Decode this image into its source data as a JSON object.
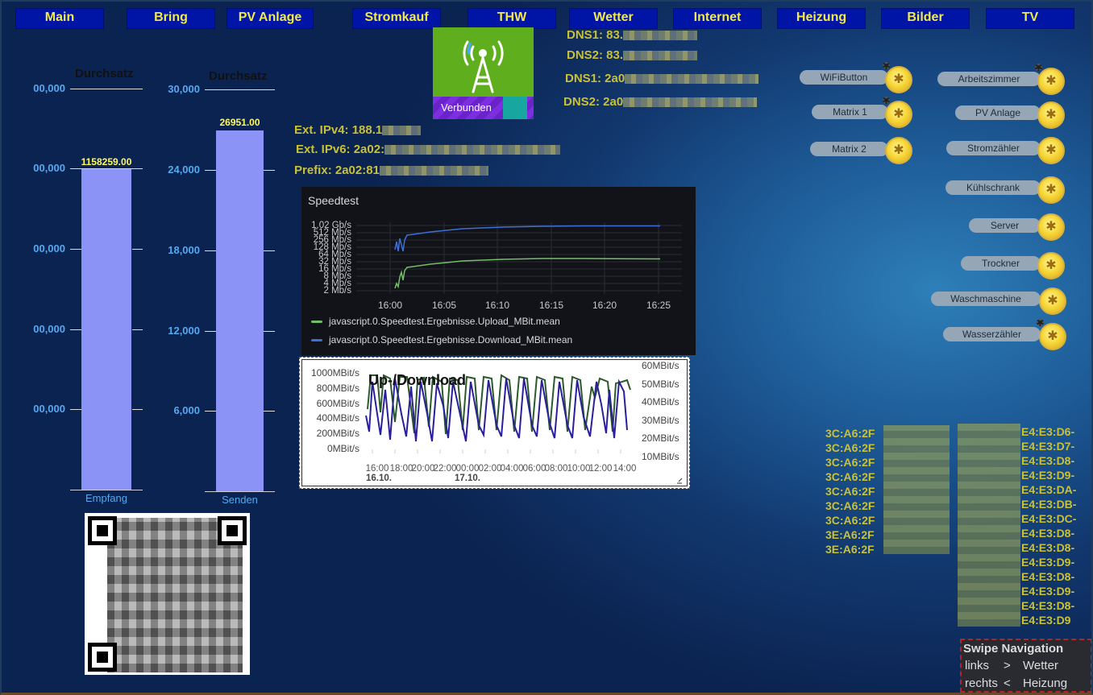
{
  "nav": [
    "Main",
    "Bring",
    "PV Anlage",
    "Stromkauf",
    "THW",
    "Wetter",
    "Internet",
    "Heizung",
    "Bilder",
    "TV"
  ],
  "gauges": {
    "left": {
      "title": "Durchsatz",
      "ticks": [
        "00,000",
        "00,000",
        "00,000",
        "00,000",
        "00,000"
      ],
      "value_label": "1158259.00",
      "value": 1158259,
      "fill_fraction": 0.8,
      "label": "Empfang"
    },
    "right": {
      "title": "Durchsatz",
      "ticks": [
        "30,000",
        "24,000",
        "18,000",
        "12,000",
        "6,000"
      ],
      "value_label": "26951.00",
      "value": 26951,
      "max": 30000,
      "label": "Senden"
    }
  },
  "tile": {
    "icon": "antenna-tower-icon",
    "status": "Verbunden"
  },
  "dns": [
    "DNS1: 83.",
    "DNS2: 83.",
    "DNS1: 2a0",
    "DNS2: 2a0"
  ],
  "ext": [
    "Ext. IPv4: 188.1",
    "Ext. IPv6: 2a02:",
    "Prefix: 2a02:81"
  ],
  "speedtest": {
    "title": "Speedtest",
    "y_labels": [
      "1.02 Gb/s",
      "512 Mb/s",
      "256 Mb/s",
      "128 Mb/s",
      "64 Mb/s",
      "32 Mb/s",
      "16 Mb/s",
      "8 Mb/s",
      "4 Mb/s",
      "2 Mb/s"
    ],
    "x_labels": [
      "16:00",
      "16:05",
      "16:10",
      "16:15",
      "16:20",
      "16:25"
    ],
    "legend": [
      {
        "name": "javascript.0.Speedtest.Ergebnisse.Upload_MBit.mean",
        "color": "#73bf69"
      },
      {
        "name": "javascript.0.Speedtest.Ergebnisse.Download_MBit.mean",
        "color": "#3d6fd8"
      }
    ]
  },
  "updown": {
    "title": "Up-/Download",
    "y_left": [
      "1000MBit/s",
      "800MBit/s",
      "600MBit/s",
      "400MBit/s",
      "200MBit/s",
      "0MBit/s"
    ],
    "y_right": [
      "60MBit/s",
      "50MBit/s",
      "40MBit/s",
      "30MBit/s",
      "20MBit/s",
      "10MBit/s"
    ],
    "x_labels": [
      "16:00",
      "18:00",
      "20:00",
      "22:00",
      "00:00",
      "02:00",
      "04:00",
      "06:00",
      "08:00",
      "10:00",
      "12:00",
      "14:00"
    ],
    "dates": [
      "16.10.",
      "17.10."
    ]
  },
  "switches_left": [
    "WiFiButton",
    "Matrix 1",
    "Matrix 2"
  ],
  "switches_right": [
    "Arbeitszimmer",
    "PV Anlage",
    "Stromzähler",
    "Kühlschrank",
    "Server",
    "Trockner",
    "Waschmaschine",
    "Wasserzähler"
  ],
  "mac_left": [
    "3C:A6:2F",
    "3C:A6:2F",
    "3C:A6:2F",
    "3C:A6:2F",
    "3C:A6:2F",
    "3C:A6:2F",
    "3C:A6:2F",
    "3E:A6:2F",
    "3E:A6:2F"
  ],
  "mac_right": [
    "E4:E3:D6-",
    "E4:E3:D7-",
    "E4:E3:D8-",
    "E4:E3:D9-",
    "E4:E3:DA-",
    "E4:E3:DB-",
    "E4:E3:DC-",
    "E4:E3:D8-",
    "E4:E3:D8-",
    "E4:E3:D9-",
    "E4:E3:D8-",
    "E4:E3:D9-",
    "E4:E3:D8-",
    "E4:E3:D9"
  ],
  "swipe": {
    "title": "Swipe Navigation",
    "row1": [
      "links",
      ">",
      "Wetter"
    ],
    "row2": [
      "rechts",
      "<",
      "Heizung"
    ]
  }
}
